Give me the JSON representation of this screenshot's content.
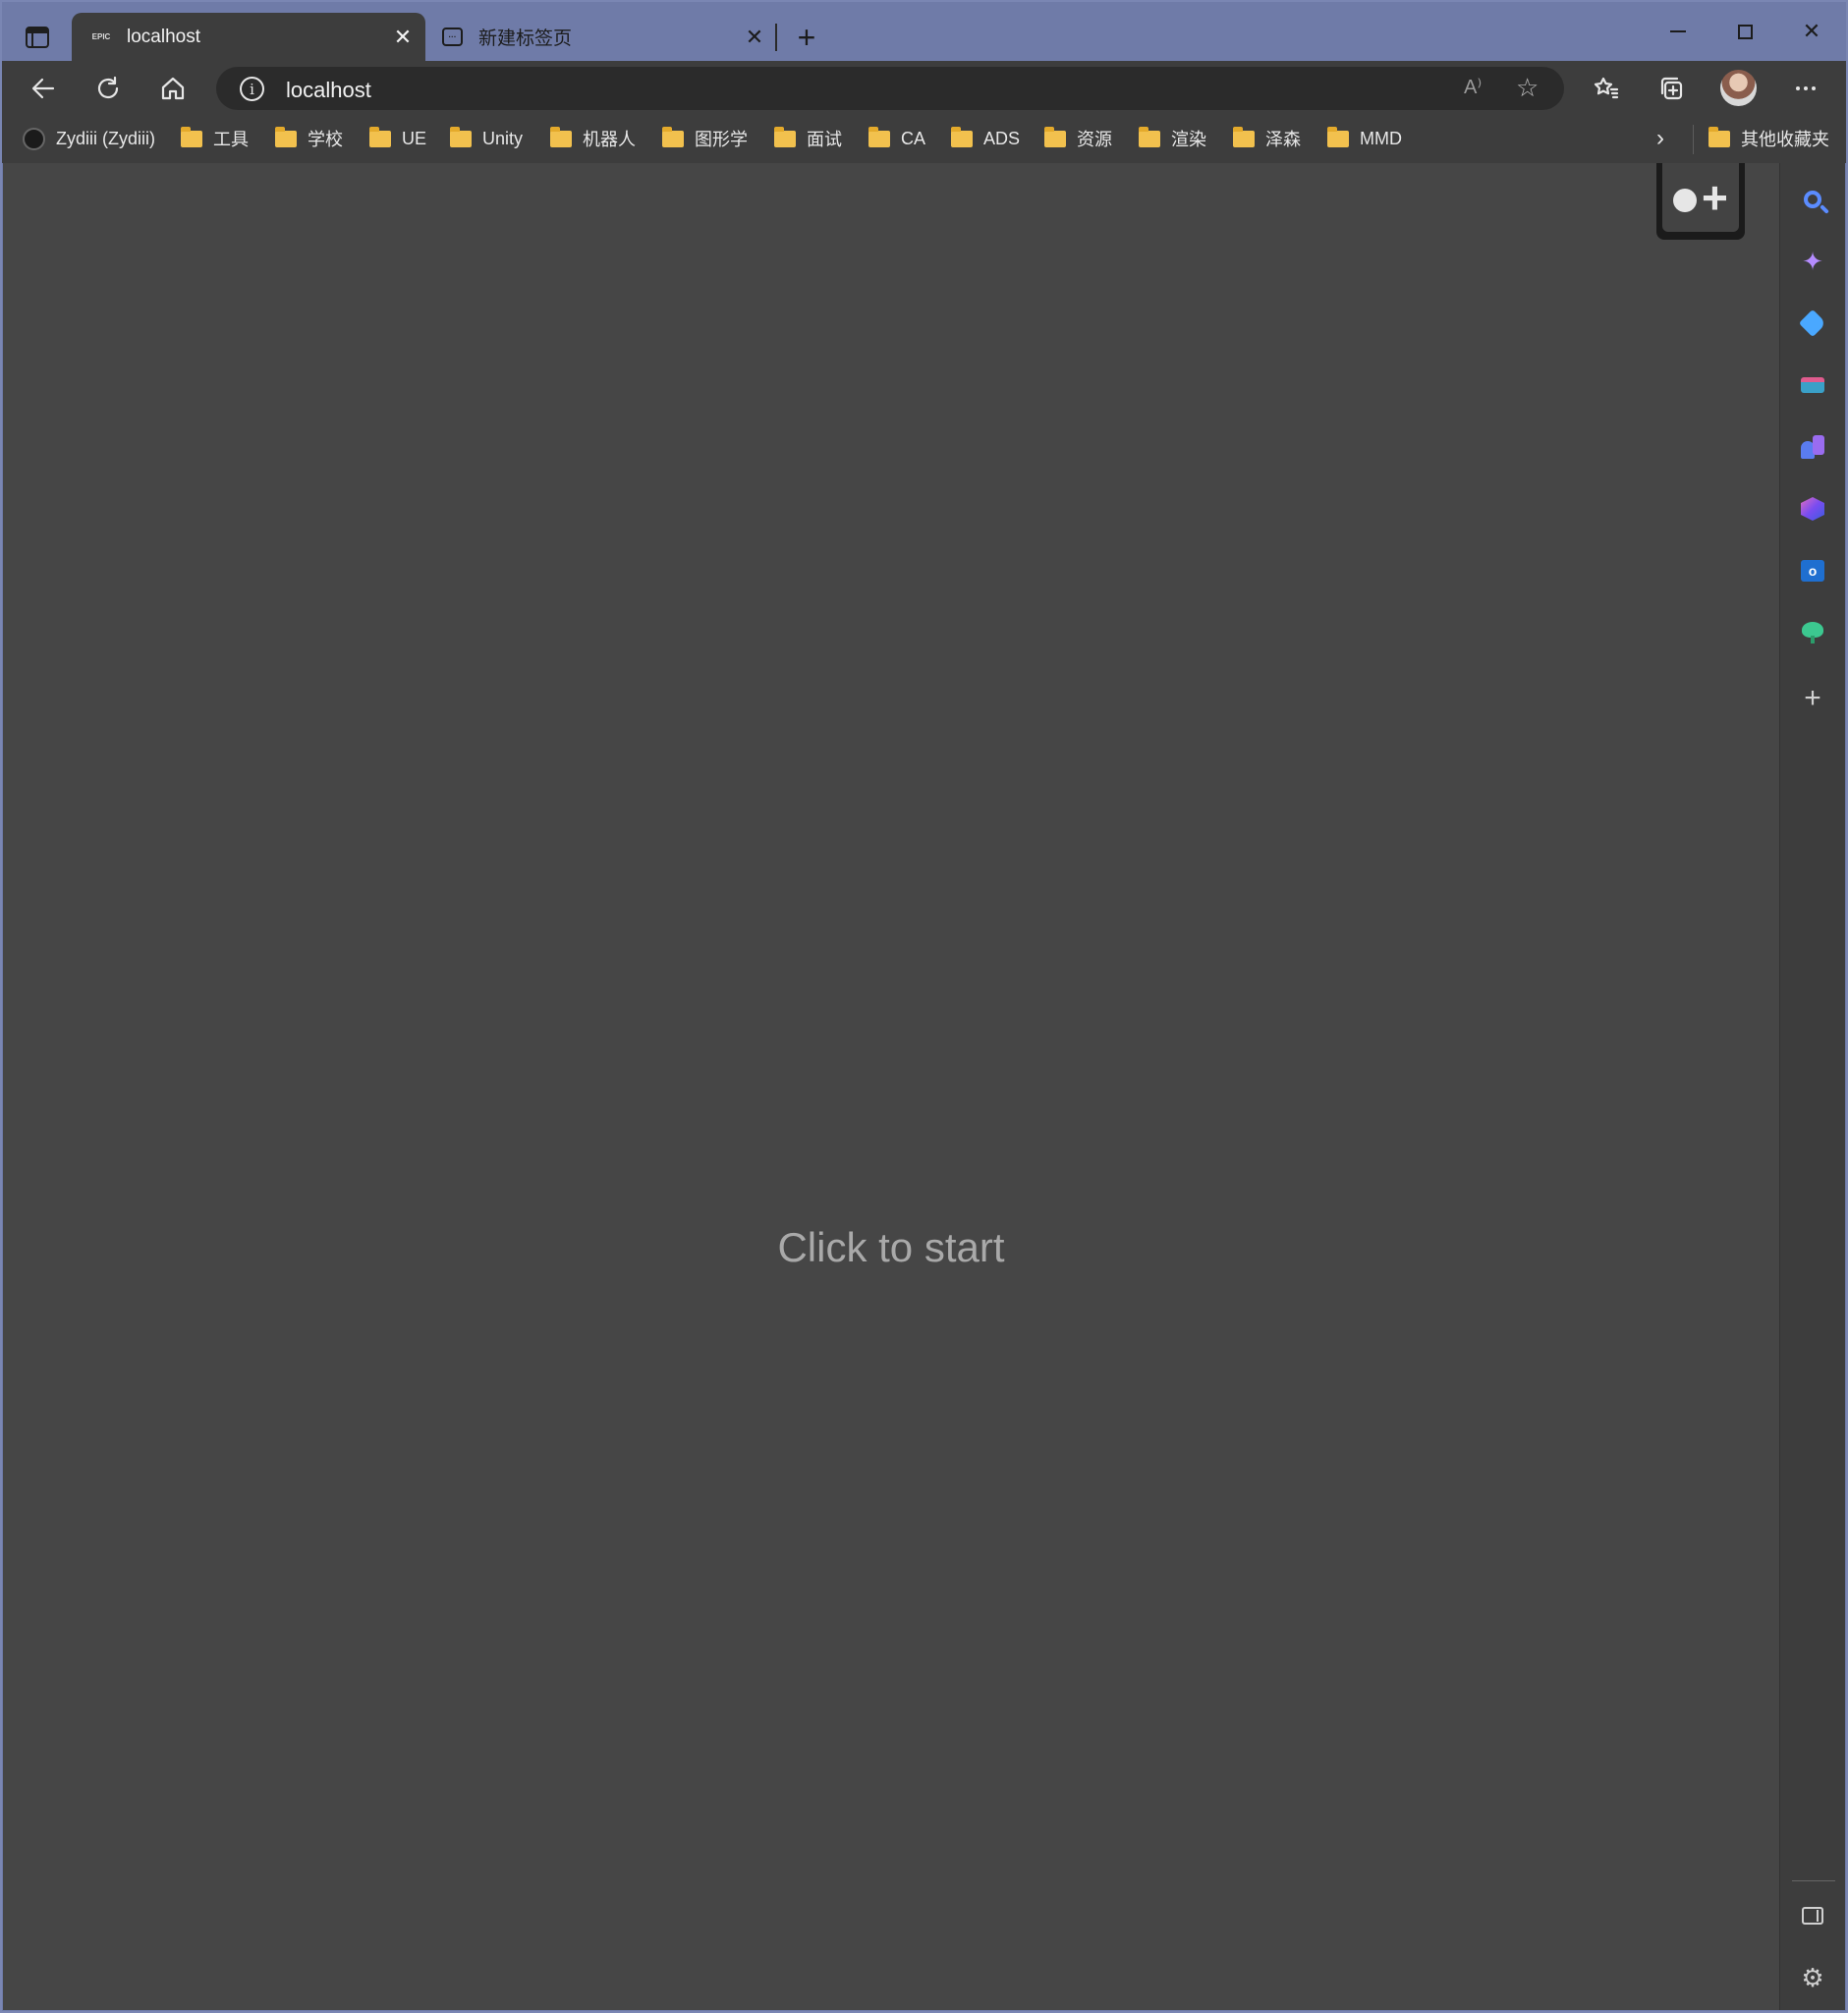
{
  "tabs": [
    {
      "favicon": "EPIC",
      "title": "localhost",
      "active": true
    },
    {
      "favicon": "newtab-icon",
      "title": "新建标签页",
      "active": false
    }
  ],
  "address_bar": {
    "url": "localhost",
    "read_aloud_glyph": "A⁾"
  },
  "bookmarks": [
    {
      "label": "Zydiii (Zydiii)",
      "icon": "github-icon"
    },
    {
      "label": "工具",
      "icon": "folder-icon"
    },
    {
      "label": "学校",
      "icon": "folder-icon"
    },
    {
      "label": "UE",
      "icon": "folder-icon"
    },
    {
      "label": "Unity",
      "icon": "folder-icon"
    },
    {
      "label": "机器人",
      "icon": "folder-icon"
    },
    {
      "label": "图形学",
      "icon": "folder-icon"
    },
    {
      "label": "面试",
      "icon": "folder-icon"
    },
    {
      "label": "CA",
      "icon": "folder-icon"
    },
    {
      "label": "ADS",
      "icon": "folder-icon"
    },
    {
      "label": "资源",
      "icon": "folder-icon"
    },
    {
      "label": "渲染",
      "icon": "folder-icon"
    },
    {
      "label": "泽森",
      "icon": "folder-icon"
    },
    {
      "label": "MMD",
      "icon": "folder-icon"
    }
  ],
  "other_bookmarks": "其他收藏夹",
  "content": {
    "prompt": "Click to start"
  },
  "sidebar": {
    "items": [
      "search-icon",
      "copilot-icon",
      "shopping-icon",
      "tools-icon",
      "games-icon",
      "office-icon",
      "outlook-icon",
      "drop-icon",
      "add-icon"
    ],
    "bottom": [
      "hide-sidebar-icon",
      "settings-icon"
    ]
  },
  "colors": {
    "frame": "#6f7ba8",
    "toolbar": "#3d3d3d",
    "content_bg": "#464646",
    "folder": "#f2c14e"
  }
}
